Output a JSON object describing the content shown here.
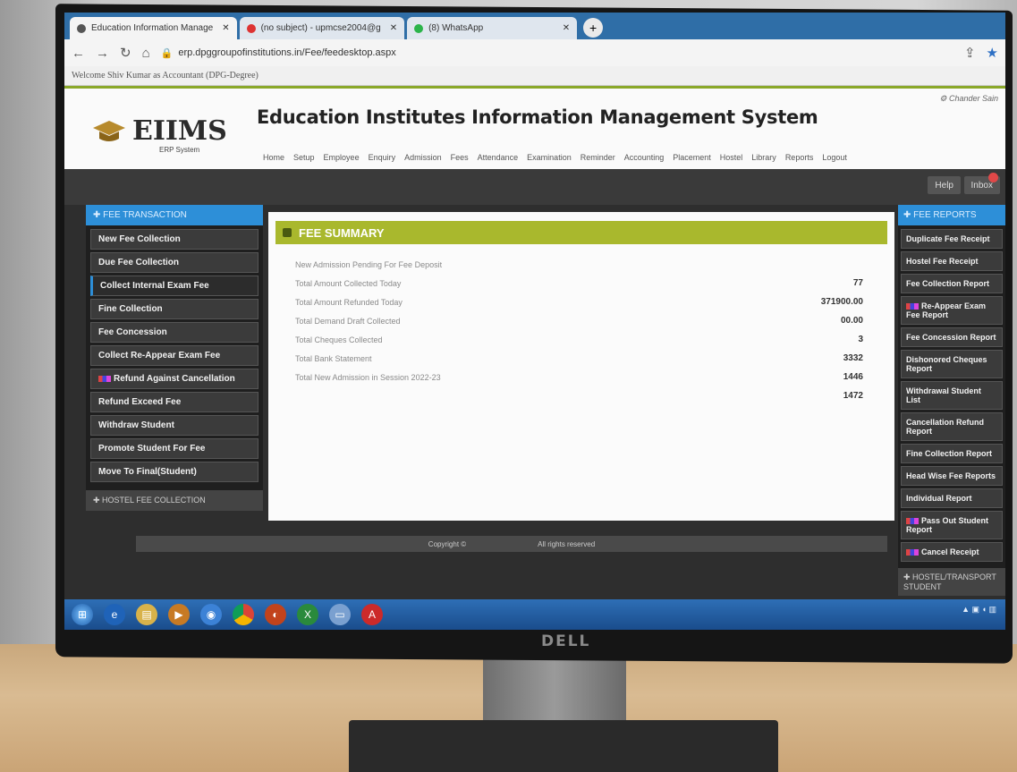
{
  "browser": {
    "tabs": [
      {
        "label": "Education Information Manage",
        "active": true
      },
      {
        "label": "(no subject) - upmcse2004@g",
        "active": false
      },
      {
        "label": "(8) WhatsApp",
        "active": false
      }
    ],
    "url": "erp.dpggroupofinstitutions.in/Fee/feedesktop.aspx",
    "welcome": "Welcome Shiv Kumar as Accountant (DPG-Degree)"
  },
  "site": {
    "logo_text": "EIIMS",
    "logo_sub": "ERP System",
    "title": "Education Institutes Information Management System",
    "user_link": "Chander Sain",
    "menu": [
      "Home",
      "Setup",
      "Employee",
      "Enquiry",
      "Admission",
      "Fees",
      "Attendance",
      "Examination",
      "Reminder",
      "Accounting",
      "Placement",
      "Hostel",
      "Library",
      "Reports",
      "Logout"
    ],
    "help_label": "Help",
    "inbox_label": "Inbox"
  },
  "left_panel": {
    "header": "FEE TRANSACTION",
    "items": [
      "New Fee Collection",
      "Due Fee Collection",
      "Collect Internal Exam Fee",
      "Fine Collection",
      "Fee Concession",
      "Collect Re-Appear Exam Fee",
      "Refund Against Cancellation",
      "Refund Exceed Fee",
      "Withdraw Student",
      "Promote Student For Fee",
      "Move To Final(Student)"
    ],
    "footer": "HOSTEL FEE COLLECTION"
  },
  "summary": {
    "header": "FEE SUMMARY",
    "rows": [
      {
        "label": "New Admission Pending For Fee Deposit",
        "value": ""
      },
      {
        "label": "Total Amount Collected Today",
        "value": "77"
      },
      {
        "label": "Total Amount Refunded Today",
        "value": "371900.00"
      },
      {
        "label": "Total Demand Draft Collected",
        "value": "00.00"
      },
      {
        "label": "Total Cheques Collected",
        "value": "3"
      },
      {
        "label": "Total Bank Statement",
        "value": "3332"
      },
      {
        "label": "Total New Admission in Session 2022-23",
        "value": "1446"
      },
      {
        "label": "",
        "value": "1472"
      }
    ]
  },
  "right_panel": {
    "header": "FEE REPORTS",
    "items": [
      "Duplicate Fee Receipt",
      "Hostel Fee Receipt",
      "Fee Collection Report",
      "Re-Appear Exam Fee Report",
      "Fee Concession Report",
      "Dishonored Cheques Report",
      "Withdrawal Student List",
      "Cancellation Refund Report",
      "Fine Collection Report",
      "Head Wise Fee Reports",
      "Individual Report",
      "Pass Out Student Report",
      "Cancel Receipt"
    ],
    "footer": "HOSTEL/TRANSPORT STUDENT"
  },
  "footer": {
    "copyright": "Copyright ©",
    "rights": "All rights reserved"
  },
  "monitor_brand": "DELL",
  "colors": {
    "accent_blue": "#2d8fd8",
    "summary_green": "#a9b82d"
  }
}
